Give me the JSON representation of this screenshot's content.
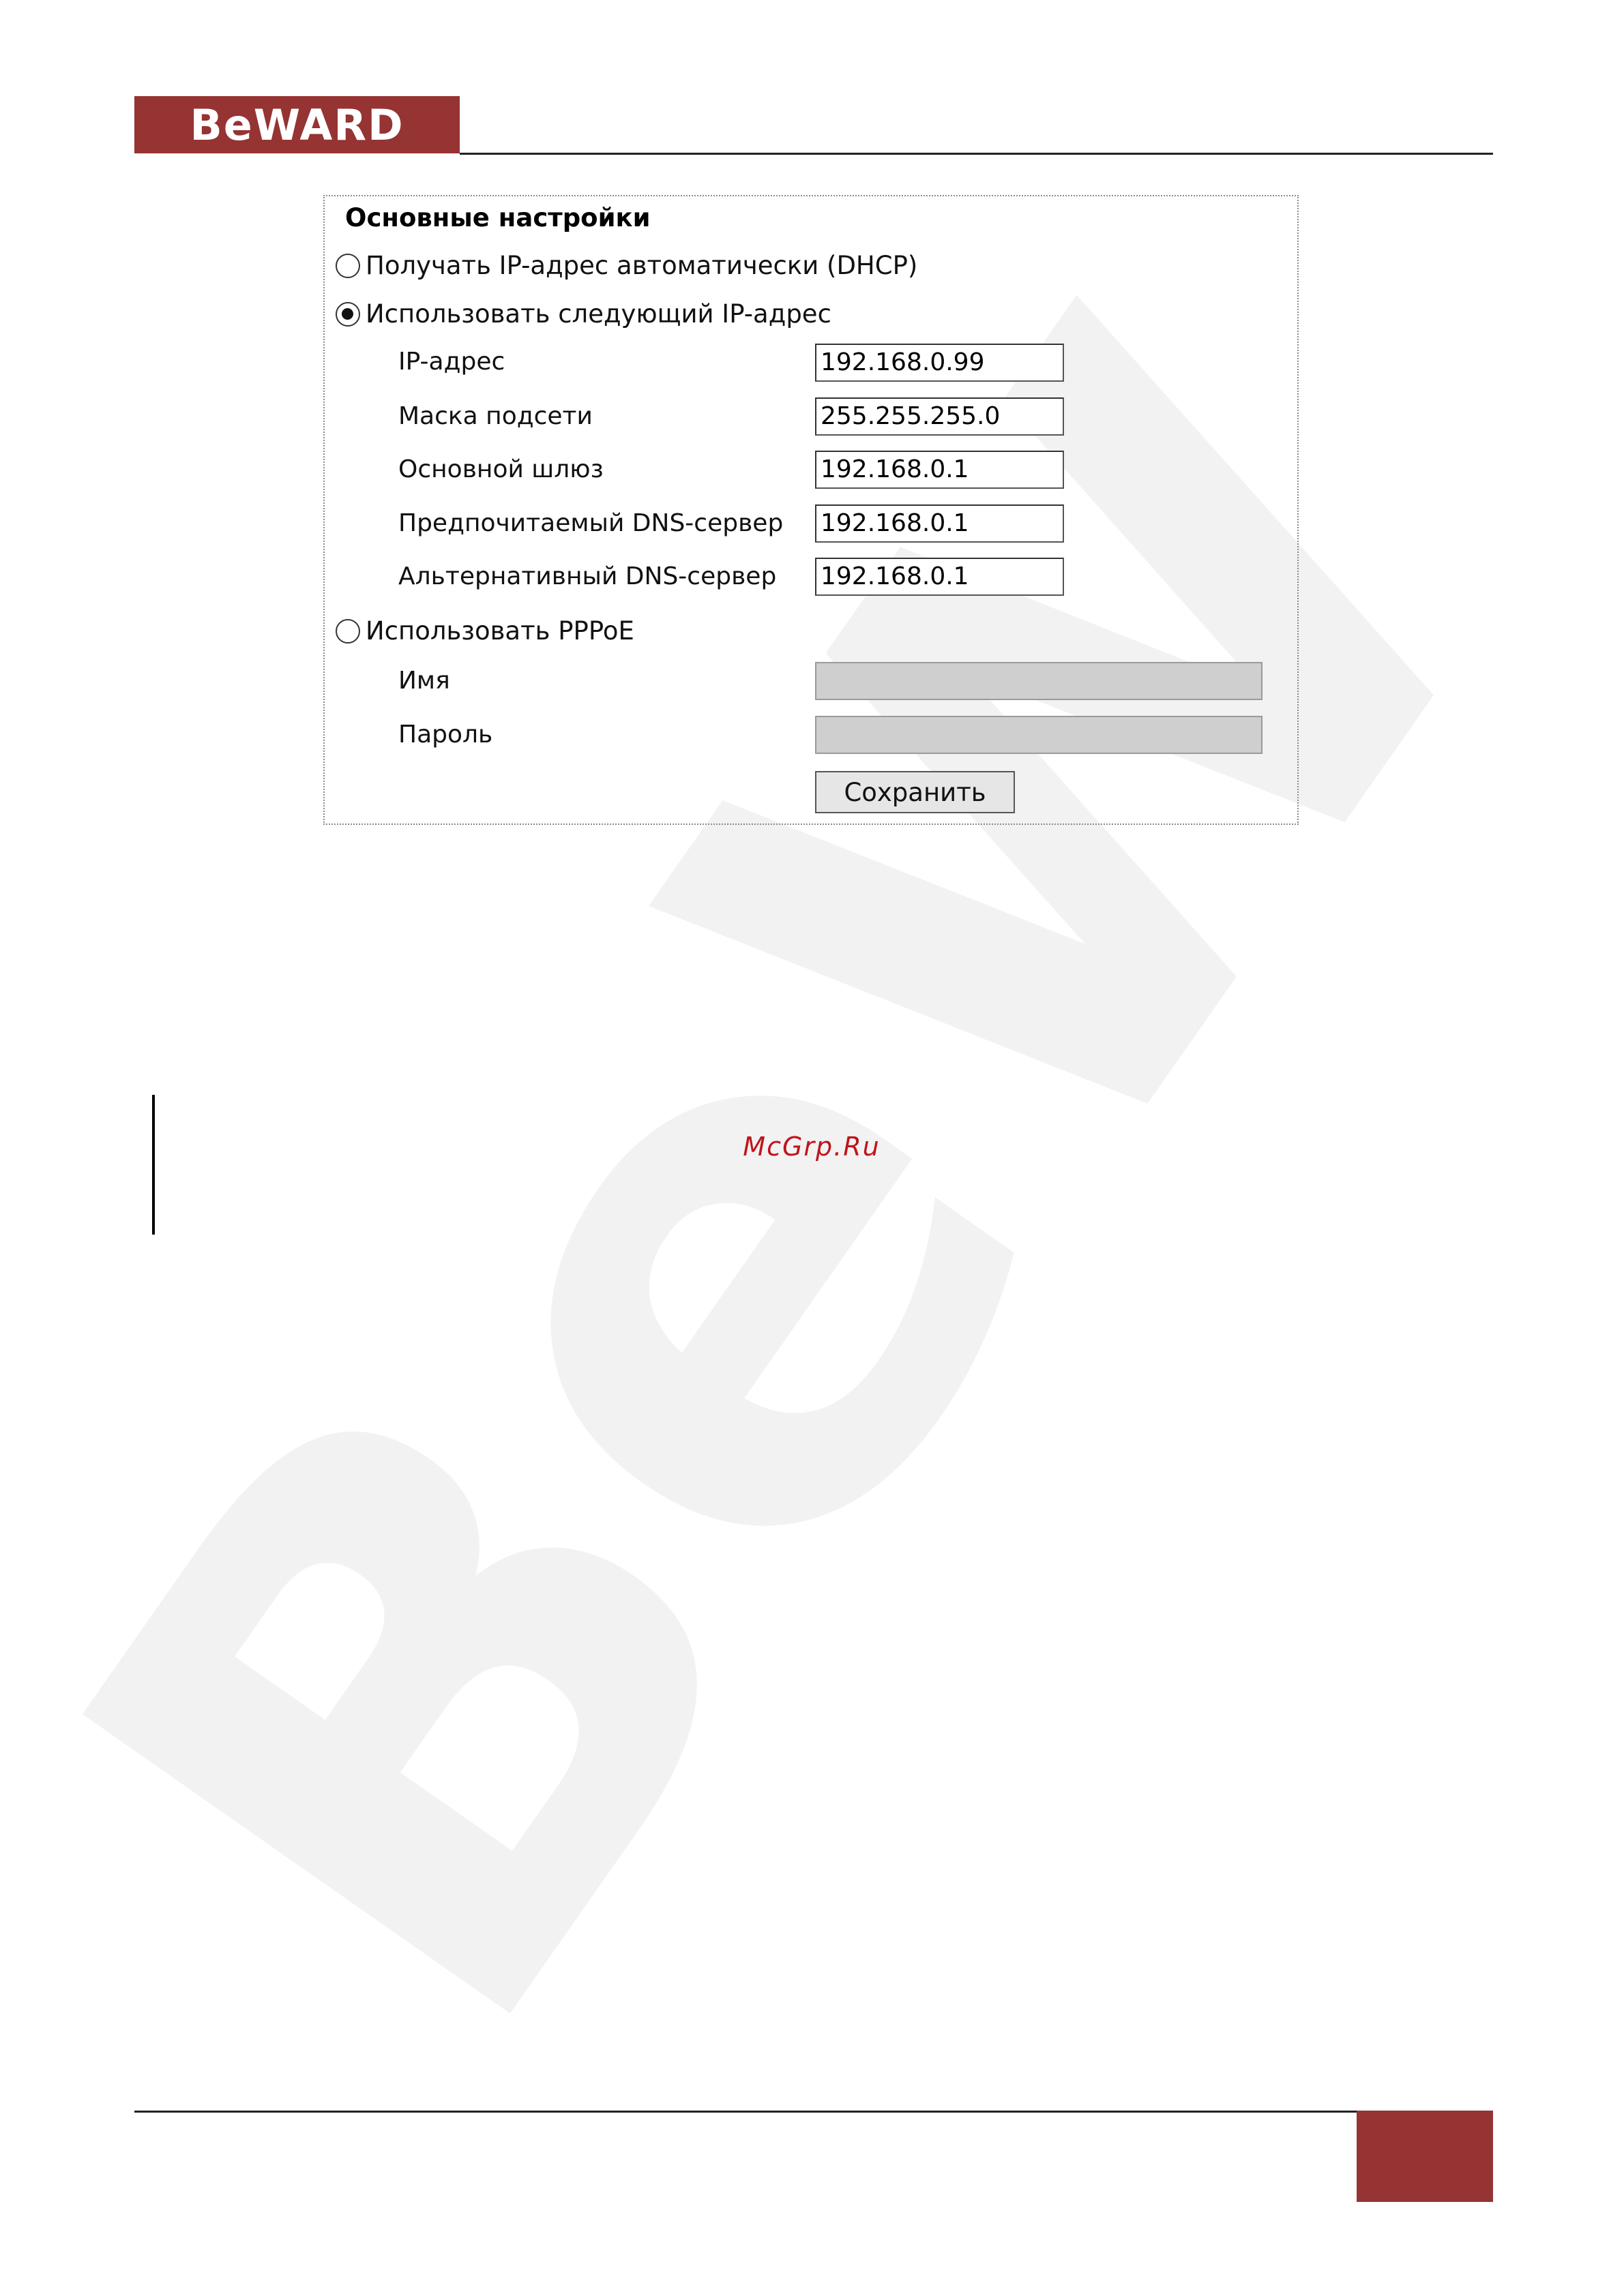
{
  "header": {
    "logo_text": "BeWARD"
  },
  "panel": {
    "title": "Основные настройки",
    "options": [
      {
        "label": "Получать IP-адрес автоматически (DHCP)",
        "selected": false
      },
      {
        "label": "Использовать следующий IP-адрес",
        "selected": true
      },
      {
        "label": "Использовать PPPoE",
        "selected": false
      }
    ],
    "static_fields": [
      {
        "label": "IP-адрес",
        "value": "192.168.0.99"
      },
      {
        "label": "Маска подсети",
        "value": "255.255.255.0"
      },
      {
        "label": "Основной шлюз",
        "value": "192.168.0.1"
      },
      {
        "label": "Предпочитаемый DNS-сервер",
        "value": "192.168.0.1"
      },
      {
        "label": "Альтернативный DNS-сервер",
        "value": "192.168.0.1"
      }
    ],
    "pppoe_fields": [
      {
        "label": "Имя",
        "value": ""
      },
      {
        "label": "Пароль",
        "value": ""
      }
    ],
    "save_label": "Сохранить"
  },
  "site_link": "McGrp.Ru",
  "footer": {
    "page_number": ""
  },
  "colors": {
    "brand": "#963333",
    "link": "#c0141b"
  }
}
